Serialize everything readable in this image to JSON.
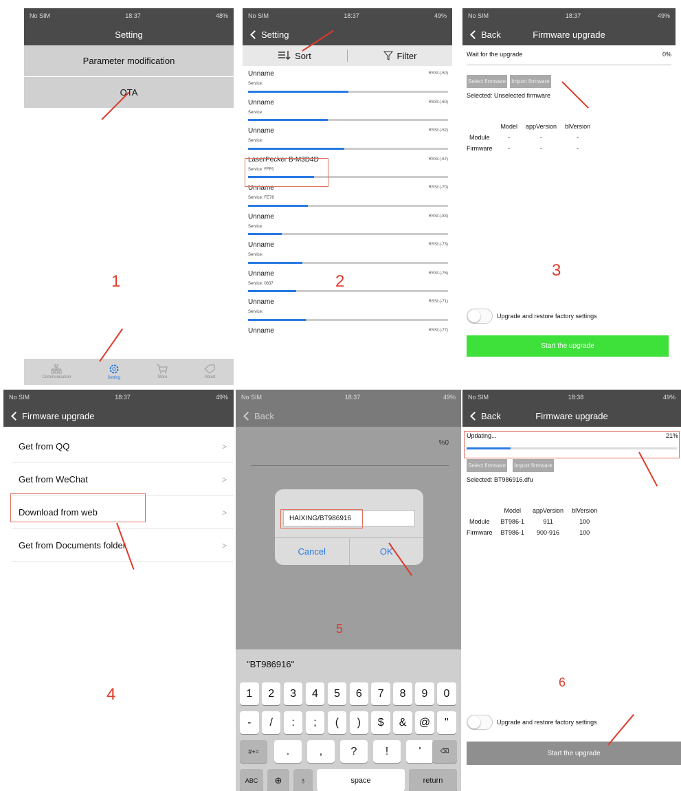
{
  "p1": {
    "status": {
      "carrier": "No SIM",
      "time": "18:37",
      "battery": "48%"
    },
    "title": "Setting",
    "rows": [
      "Parameter modification",
      "OTA"
    ],
    "step": "1",
    "tabs": [
      "Communication",
      "Setting",
      "Store",
      "About"
    ]
  },
  "p2": {
    "status": {
      "carrier": "No SIM",
      "time": "18:37",
      "battery": "49%"
    },
    "back": "Setting",
    "sort": "Sort",
    "filter": "Filter",
    "step": "2",
    "devices": [
      {
        "name": "Unname",
        "rssi": "RSSI:(-50)",
        "service": "Service:",
        "fill": 0.5
      },
      {
        "name": "Unname",
        "rssi": "RSSI:(-60)",
        "service": "Service:",
        "fill": 0.4
      },
      {
        "name": "Unname",
        "rssi": "RSSI:(-52)",
        "service": "Service:",
        "fill": 0.48
      },
      {
        "name": "LaserPecker B-M3D4D",
        "rssi": "RSSI:(-67)",
        "service": "Service:  FFF0",
        "fill": 0.33
      },
      {
        "name": "Unname",
        "rssi": "RSSI:(-70)",
        "service": "Service:  FE78",
        "fill": 0.3
      },
      {
        "name": "Unname",
        "rssi": "RSSI:(-83)",
        "service": "Service:",
        "fill": 0.17
      },
      {
        "name": "Unname",
        "rssi": "RSSI:(-73)",
        "service": "Service:",
        "fill": 0.27
      },
      {
        "name": "Unname",
        "rssi": "RSSI:(-76)",
        "service": "Service:  0837",
        "fill": 0.24
      },
      {
        "name": "Unname",
        "rssi": "RSSI:(-71)",
        "service": "Service:",
        "fill": 0.29
      },
      {
        "name": "Unname",
        "rssi": "RSSI:(-77)",
        "service": "",
        "fill": 0
      }
    ]
  },
  "p3": {
    "status": {
      "carrier": "No SIM",
      "time": "18:37",
      "battery": "49%"
    },
    "back": "Back",
    "title": "Firmware upgrade",
    "wait": "Wait for the upgrade",
    "percent": "0%",
    "select_btn": "Select firmware",
    "import_btn": "Import firmware",
    "selected": "Selected:  Unselected firmware",
    "headers": [
      "",
      "Model",
      "appVersion",
      "blVersion"
    ],
    "rows": [
      [
        "Module",
        "-",
        "-",
        "-"
      ],
      [
        "Firmware",
        "-",
        "-",
        "-"
      ]
    ],
    "step": "3",
    "toggle": "Upgrade and restore factory settings",
    "start": "Start the upgrade",
    "start_color": "#3ee03a"
  },
  "p4": {
    "status": {
      "carrier": "No SIM",
      "time": "18:37",
      "battery": "49%"
    },
    "back": "Firmware upgrade",
    "items": [
      "Get from QQ",
      "Get from WeChat",
      "Download from web",
      "Get from Documents folder"
    ],
    "step": "4"
  },
  "p5": {
    "status": {
      "carrier": "No SIM",
      "time": "18:37",
      "battery": "49%"
    },
    "back": "Back",
    "percent": "%0",
    "input": "HAIXING/BT986916",
    "cancel": "Cancel",
    "ok": "OK",
    "step": "5",
    "suggestion": "\"BT986916\"",
    "row1": [
      "1",
      "2",
      "3",
      "4",
      "5",
      "6",
      "7",
      "8",
      "9",
      "0"
    ],
    "row2": [
      "-",
      "/",
      ":",
      ";",
      "(",
      ")",
      "$",
      "&",
      "@",
      "\""
    ],
    "row3": [
      "#+=",
      ".",
      ",",
      "?",
      "!",
      "'",
      "⌫"
    ],
    "row4": [
      "ABC",
      "space",
      "return"
    ]
  },
  "p6": {
    "status": {
      "carrier": "No SIM",
      "time": "18:38",
      "battery": "49%"
    },
    "back": "Back",
    "title": "Firmware upgrade",
    "updating": "Updating...",
    "percent": "21%",
    "progress": 0.21,
    "select_btn": "Select firmware",
    "import_btn": "Import firmware",
    "selected": "Selected:  BT986916.dfu",
    "headers": [
      "",
      "Model",
      "appVersion",
      "blVersion"
    ],
    "rows": [
      [
        "Module",
        "BT986-1",
        "911",
        "100"
      ],
      [
        "Firmware",
        "BT986-1",
        "900-916",
        "100"
      ]
    ],
    "step": "6",
    "toggle": "Upgrade and restore factory settings",
    "start": "Start the upgrade"
  }
}
